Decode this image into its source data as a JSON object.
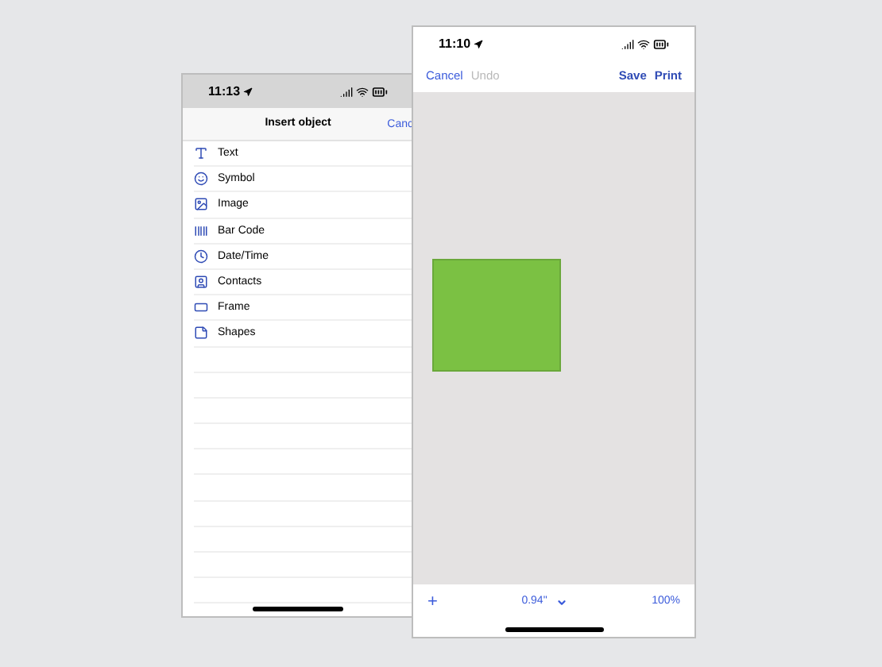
{
  "back_phone": {
    "status_time": "11:13",
    "title": "Insert object",
    "cancel": "Canc",
    "items": [
      {
        "label": "Text"
      },
      {
        "label": "Symbol"
      },
      {
        "label": "Image"
      },
      {
        "label": "Bar Code"
      },
      {
        "label": "Date/Time"
      },
      {
        "label": "Contacts"
      },
      {
        "label": "Frame"
      },
      {
        "label": "Shapes"
      }
    ]
  },
  "front_phone": {
    "status_time": "11:10",
    "nav": [
      {
        "label": "Cancel",
        "disabled": false
      },
      {
        "label": "Undo",
        "disabled": true
      },
      {
        "label": "Save",
        "disabled": false
      },
      {
        "label": "Print",
        "disabled": false
      }
    ],
    "bottom": {
      "add": "+",
      "size": "0.94\"",
      "zoom": "100%"
    }
  }
}
